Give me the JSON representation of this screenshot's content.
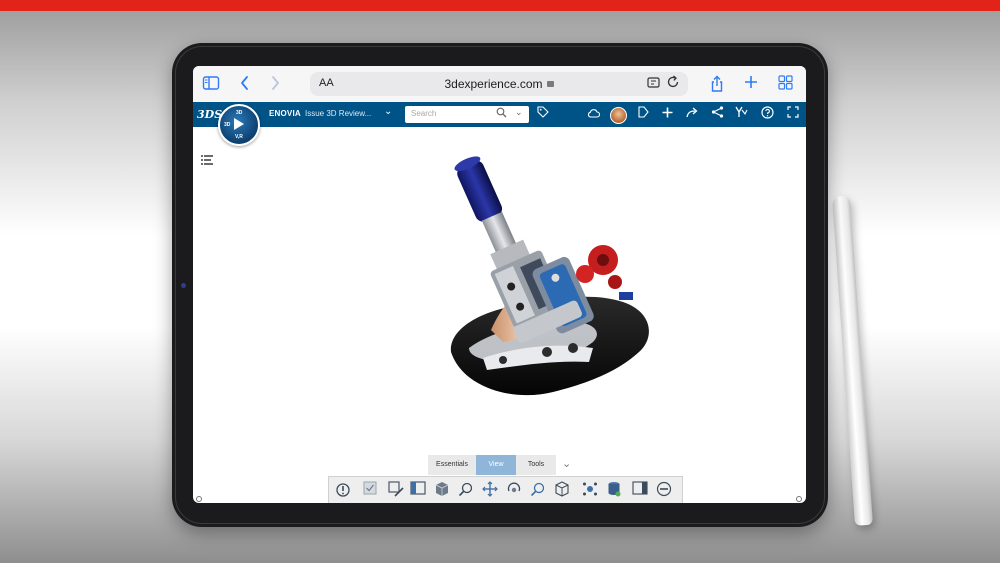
{
  "safari": {
    "address_prefix": "AA",
    "url": "3dexperience.com",
    "icons": [
      "sidebar-icon",
      "back-icon",
      "forward-icon",
      "reader-icon",
      "reload-icon",
      "share-icon",
      "new-tab-icon",
      "tabs-overview-icon"
    ]
  },
  "toolbar": {
    "brand": "ENOVIA",
    "document_title": "Issue 3D Review...",
    "search_placeholder": "Search",
    "icons": [
      "tag-icon",
      "cloud-icon",
      "user-avatar",
      "tag-arrow-icon",
      "add-icon",
      "share-forward-icon",
      "collaborate-icon",
      "apps-icon",
      "help-icon",
      "fullscreen-icon"
    ]
  },
  "compass": {
    "top_label": "3D",
    "bottom_label": "V,R",
    "left_label": "3D"
  },
  "action_tabs": [
    {
      "label": "Essentials",
      "active": false
    },
    {
      "label": "View",
      "active": true
    },
    {
      "label": "Tools",
      "active": false
    }
  ],
  "colors": {
    "brand_bar": "#e2231a",
    "toolbar": "#005386",
    "active_tab": "#8fb6d8",
    "safari_accent": "#2f7bf5"
  }
}
